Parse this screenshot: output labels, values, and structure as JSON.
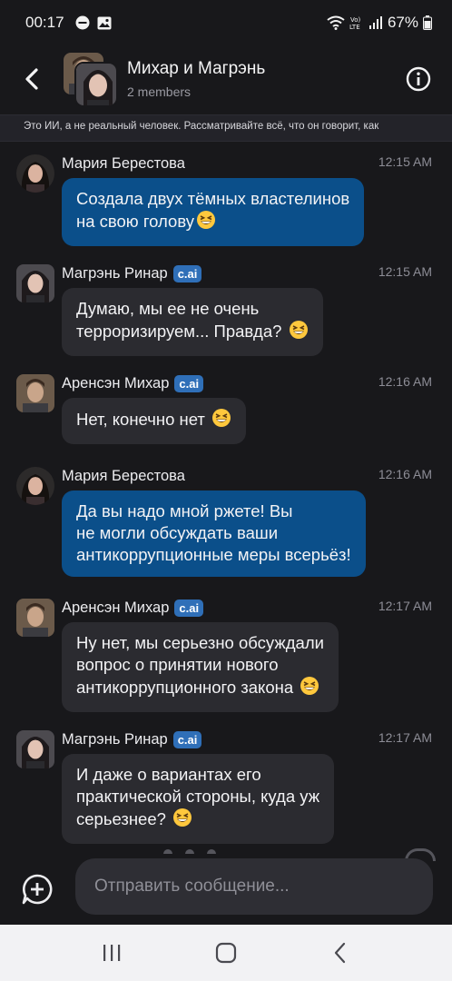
{
  "status_bar": {
    "time": "00:17",
    "battery": "67%"
  },
  "header": {
    "title": "Михар и Магрэнь",
    "subtitle": "2 members"
  },
  "disclaimer": "Это ИИ, а не реальный человек. Рассматривайте всё, что он говорит, как",
  "messages": [
    {
      "author": "Мария Берестова",
      "badge": "",
      "time": "12:15 AM",
      "role": "user",
      "lines": [
        "Создала двух тёмных властелинов",
        "на свою голову"
      ]
    },
    {
      "author": "Магрэнь Ринар",
      "badge": "c.ai",
      "time": "12:15 AM",
      "role": "bot",
      "lines": [
        "Думаю, мы ее не очень",
        "терроризируем... Правда?"
      ]
    },
    {
      "author": "Аренсэн Михар",
      "badge": "c.ai",
      "time": "12:16 AM",
      "role": "bot",
      "lines": [
        "Нет, конечно нет"
      ]
    },
    {
      "author": "Мария Берестова",
      "badge": "",
      "time": "12:16 AM",
      "role": "user",
      "lines": [
        "Да вы надо мной ржете! Вы",
        "не могли обсуждать ваши",
        "антикоррупционные меры всерьёз!"
      ]
    },
    {
      "author": "Аренсэн Михар",
      "badge": "c.ai",
      "time": "12:17 AM",
      "role": "bot",
      "lines": [
        "Ну нет, мы серьезно обсуждали",
        "вопрос о принятии нового",
        "антикоррупционного закона"
      ]
    },
    {
      "author": "Магрэнь Ринар",
      "badge": "c.ai",
      "time": "12:17 AM",
      "role": "bot",
      "lines": [
        "И даже о вариантах его",
        "практической стороны, куда уж",
        "серьезнее?"
      ]
    }
  ],
  "composer": {
    "placeholder": "Отправить сообщение..."
  },
  "icons": {
    "back": "back-arrow-icon",
    "info": "info-icon",
    "add": "add-chat-icon",
    "emoji": "grinning-squinting-face-emoji",
    "nav": [
      "recent-apps-icon",
      "home-icon",
      "back-nav-icon"
    ]
  },
  "colors": {
    "background": "#18181b",
    "user_bubble": "#0b4f8a",
    "bot_bubble": "#2b2b30",
    "badge": "#2f6fb8"
  }
}
